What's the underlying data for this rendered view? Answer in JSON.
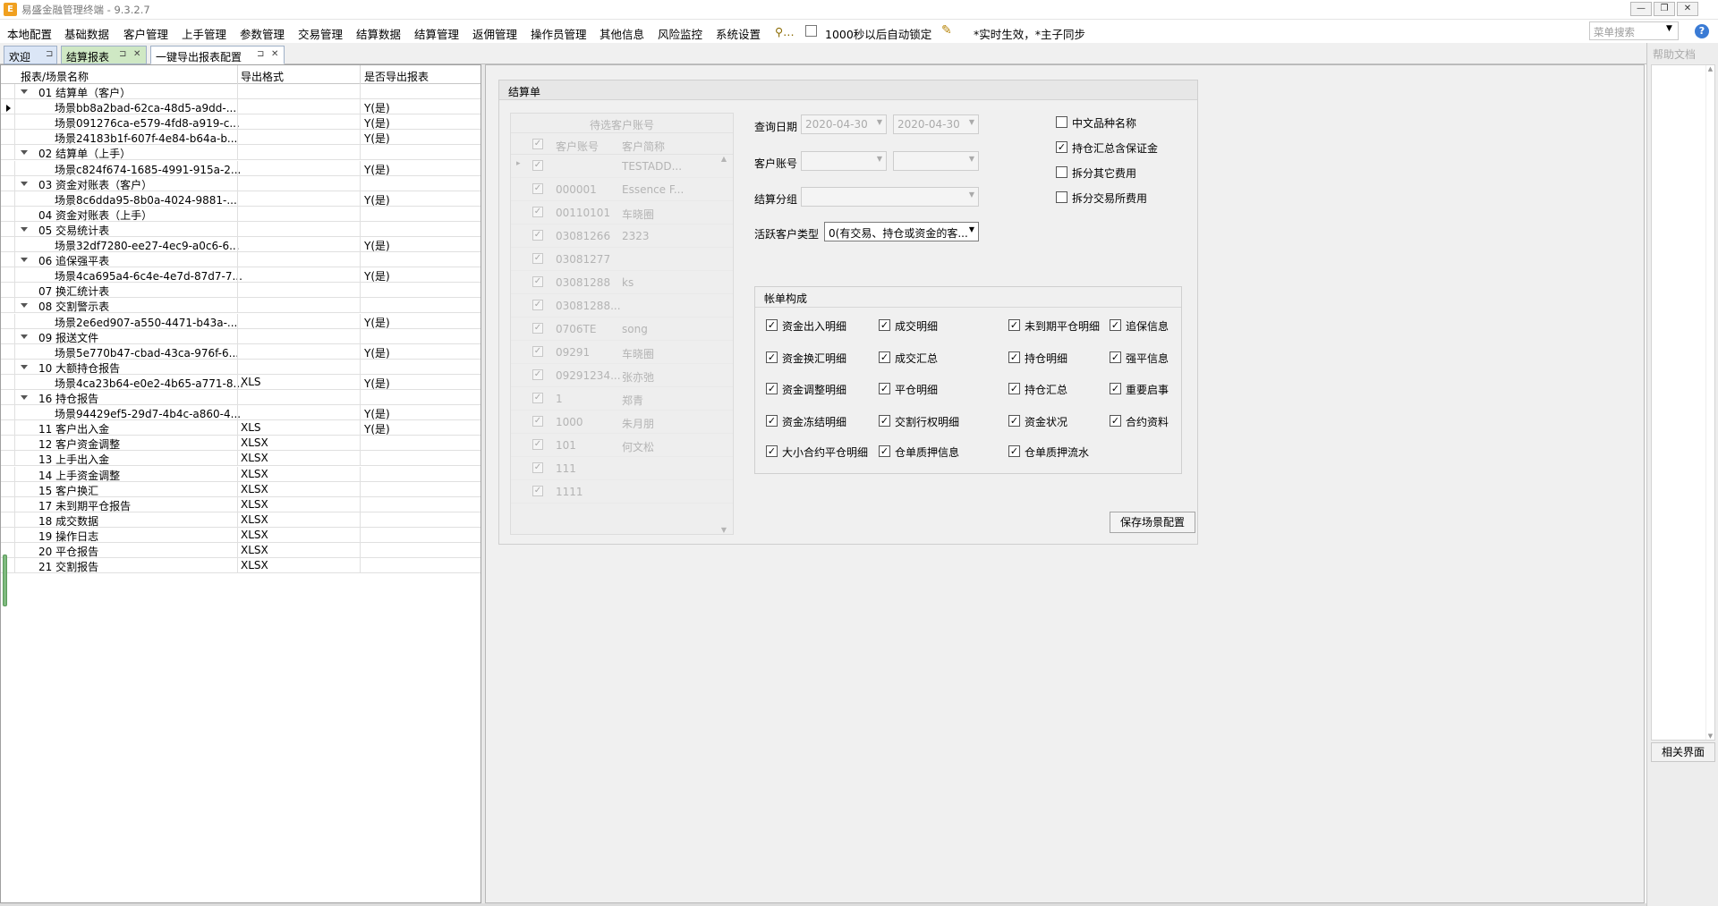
{
  "window": {
    "title": "易盛金融管理终端 - 9.3.2.7",
    "icon_letter": "E",
    "buttons": {
      "minimize": "—",
      "restore": "❐",
      "close": "✕"
    }
  },
  "menu": {
    "items": [
      "本地配置",
      "基础数据",
      "客户管理",
      "上手管理",
      "参数管理",
      "交易管理",
      "结算数据",
      "结算管理",
      "返佣管理",
      "操作员管理",
      "其他信息",
      "风险监控",
      "系统设置"
    ],
    "tool_glyph": "⚲…",
    "autolock": {
      "label": "1000秒以后自动锁定",
      "checked": false
    },
    "notice": "*实时生效，*主子同步",
    "search_placeholder": "菜单搜索",
    "help_glyph": "?"
  },
  "tabs": [
    {
      "label": "欢迎",
      "pin": "⊐"
    },
    {
      "label": "结算报表",
      "pin": "⊐",
      "close": "✕"
    },
    {
      "label": "一键导出报表配置",
      "pin": "⊐",
      "close": "✕"
    }
  ],
  "help_panel": {
    "title": "帮助文档",
    "related_button": "相关界面",
    "scroll_up": "▲",
    "scroll_down": "▼"
  },
  "report_grid": {
    "headers": [
      "报表/场景名称",
      "导出格式",
      "是否导出报表"
    ],
    "rows": [
      {
        "level": 0,
        "expanded": true,
        "name": "01 结算单（客户）",
        "format": "",
        "export": ""
      },
      {
        "level": 1,
        "current": true,
        "name": "场景bb8a2bad-62ca-48d5-a9dd-...",
        "format": "",
        "export": "Y(是)"
      },
      {
        "level": 1,
        "name": "场景091276ca-e579-4fd8-a919-c...",
        "format": "",
        "export": "Y(是)"
      },
      {
        "level": 1,
        "name": "场景24183b1f-607f-4e84-b64a-b...",
        "format": "",
        "export": "Y(是)"
      },
      {
        "level": 0,
        "expanded": true,
        "name": "02 结算单（上手）",
        "format": "",
        "export": ""
      },
      {
        "level": 1,
        "name": "场景c824f674-1685-4991-915a-2...",
        "format": "",
        "export": "Y(是)"
      },
      {
        "level": 0,
        "expanded": true,
        "name": "03 资金对账表（客户）",
        "format": "",
        "export": ""
      },
      {
        "level": 1,
        "name": "场景8c6dda95-8b0a-4024-9881-...",
        "format": "",
        "export": "Y(是)"
      },
      {
        "level": 0,
        "name": "04 资金对账表（上手）",
        "format": "",
        "export": ""
      },
      {
        "level": 0,
        "expanded": true,
        "name": "05 交易统计表",
        "format": "",
        "export": ""
      },
      {
        "level": 1,
        "name": "场景32df7280-ee27-4ec9-a0c6-6...",
        "format": "",
        "export": "Y(是)"
      },
      {
        "level": 0,
        "expanded": true,
        "name": "06 追保强平表",
        "format": "",
        "export": ""
      },
      {
        "level": 1,
        "name": "场景4ca695a4-6c4e-4e7d-87d7-7...",
        "format": "",
        "export": "Y(是)"
      },
      {
        "level": 0,
        "name": "07 换汇统计表",
        "format": "",
        "export": ""
      },
      {
        "level": 0,
        "expanded": true,
        "name": "08 交割警示表",
        "format": "",
        "export": ""
      },
      {
        "level": 1,
        "name": "场景2e6ed907-a550-4471-b43a-...",
        "format": "",
        "export": "Y(是)"
      },
      {
        "level": 0,
        "expanded": true,
        "name": "09 报送文件",
        "format": "",
        "export": ""
      },
      {
        "level": 1,
        "name": "场景5e770b47-cbad-43ca-976f-6...",
        "format": "",
        "export": "Y(是)"
      },
      {
        "level": 0,
        "expanded": true,
        "name": "10 大额持仓报告",
        "format": "",
        "export": ""
      },
      {
        "level": 1,
        "name": "场景4ca23b64-e0e2-4b65-a771-8...",
        "format": "XLS",
        "export": "Y(是)"
      },
      {
        "level": 0,
        "expanded": true,
        "name": "16 持仓报告",
        "format": "",
        "export": ""
      },
      {
        "level": 1,
        "name": "场景94429ef5-29d7-4b4c-a860-4...",
        "format": "",
        "export": "Y(是)"
      },
      {
        "level": 0,
        "name": "11 客户出入金",
        "format": "XLS",
        "export": "Y(是)"
      },
      {
        "level": 0,
        "name": "12 客户资金调整",
        "format": "XLSX",
        "export": ""
      },
      {
        "level": 0,
        "name": "13 上手出入金",
        "format": "XLSX",
        "export": ""
      },
      {
        "level": 0,
        "name": "14 上手资金调整",
        "format": "XLSX",
        "export": ""
      },
      {
        "level": 0,
        "name": "15 客户换汇",
        "format": "XLSX",
        "export": ""
      },
      {
        "level": 0,
        "name": "17 未到期平仓报告",
        "format": "XLSX",
        "export": ""
      },
      {
        "level": 0,
        "name": "18 成交数据",
        "format": "XLSX",
        "export": ""
      },
      {
        "level": 0,
        "name": "19 操作日志",
        "format": "XLSX",
        "export": ""
      },
      {
        "level": 0,
        "name": "20 平仓报告",
        "format": "XLSX",
        "export": ""
      },
      {
        "level": 0,
        "name": "21 交割报告",
        "format": "XLSX",
        "export": ""
      }
    ]
  },
  "settle": {
    "group_title": "结算单",
    "acct_grid": {
      "title": "待选客户账号",
      "headers": [
        "客户账号",
        "客户简称"
      ],
      "rows": [
        {
          "acct": "",
          "name": "TESTADD..."
        },
        {
          "acct": "000001",
          "name": "Essence F..."
        },
        {
          "acct": "00110101",
          "name": "车晓圈"
        },
        {
          "acct": "03081266",
          "name": "2323"
        },
        {
          "acct": "03081277",
          "name": ""
        },
        {
          "acct": "03081288",
          "name": "ks"
        },
        {
          "acct": "03081288...",
          "name": ""
        },
        {
          "acct": "0706TE",
          "name": "song"
        },
        {
          "acct": "09291",
          "name": "车晓圈"
        },
        {
          "acct": "09291234...",
          "name": "张亦弛"
        },
        {
          "acct": "1",
          "name": "郑青"
        },
        {
          "acct": "1000",
          "name": "朱月朋"
        },
        {
          "acct": "101",
          "name": "何文松"
        },
        {
          "acct": "111",
          "name": ""
        },
        {
          "acct": "1111",
          "name": ""
        }
      ]
    },
    "query_date": {
      "label": "查询日期",
      "from": "2020-04-30",
      "to": "2020-04-30"
    },
    "client_account": {
      "label": "客户账号",
      "value1": "",
      "value2": ""
    },
    "settle_group": {
      "label": "结算分组",
      "value": ""
    },
    "active_client_type": {
      "label": "活跃客户类型",
      "value": "0(有交易、持仓或资金的客..."
    },
    "options": [
      {
        "label": "中文品种名称",
        "checked": false
      },
      {
        "label": "持仓汇总含保证金",
        "checked": true
      },
      {
        "label": "拆分其它费用",
        "checked": false
      },
      {
        "label": "拆分交易所费用",
        "checked": false
      }
    ],
    "bill": {
      "title": "帐单构成",
      "items": [
        {
          "label": "资金出入明细",
          "checked": true
        },
        {
          "label": "成交明细",
          "checked": true
        },
        {
          "label": "未到期平仓明细",
          "checked": true
        },
        {
          "label": "追保信息",
          "checked": true
        },
        {
          "label": "资金换汇明细",
          "checked": true
        },
        {
          "label": "成交汇总",
          "checked": true
        },
        {
          "label": "持仓明细",
          "checked": true
        },
        {
          "label": "强平信息",
          "checked": true
        },
        {
          "label": "资金调整明细",
          "checked": true
        },
        {
          "label": "平仓明细",
          "checked": true
        },
        {
          "label": "持仓汇总",
          "checked": true
        },
        {
          "label": "重要启事",
          "checked": true
        },
        {
          "label": "资金冻结明细",
          "checked": true
        },
        {
          "label": "交割行权明细",
          "checked": true
        },
        {
          "label": "资金状况",
          "checked": true
        },
        {
          "label": "合约资料",
          "checked": true
        },
        {
          "label": "大小合约平仓明细",
          "checked": true
        },
        {
          "label": "仓单质押信息",
          "checked": true
        },
        {
          "label": "仓单质押流水",
          "checked": true
        }
      ]
    },
    "save_button": "保存场景配置"
  }
}
